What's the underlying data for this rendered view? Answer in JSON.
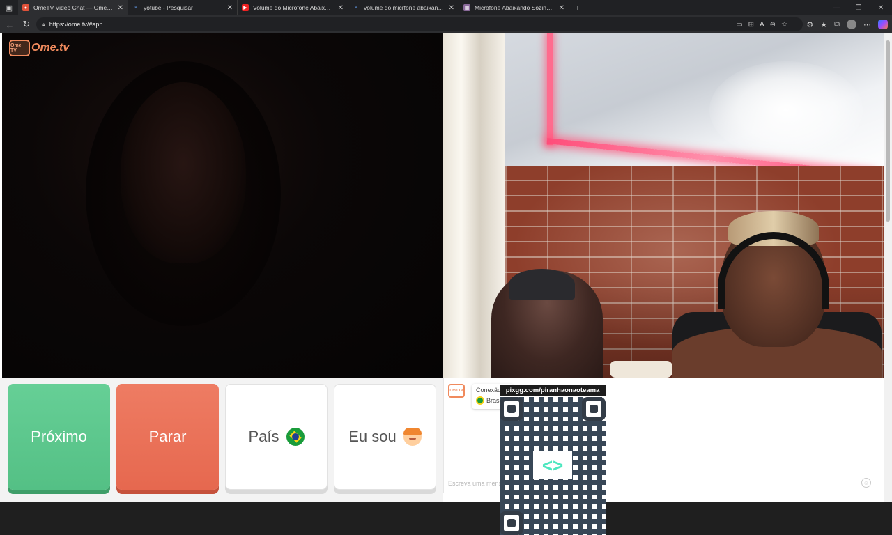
{
  "tabs": [
    {
      "title": "OmeTV Video Chat — Omegle",
      "active": true
    },
    {
      "title": "yotube - Pesquisar",
      "active": false
    },
    {
      "title": "Volume do Microfone Abaixando",
      "active": false
    },
    {
      "title": "volume do micrfone abaixando s",
      "active": false
    },
    {
      "title": "Microfone Abaixando Sozinho (S",
      "active": false
    }
  ],
  "address_bar": {
    "url": "https://ome.tv/#app"
  },
  "logo": {
    "icon_text": "Ome TV",
    "name": "Ome.tv"
  },
  "controls": {
    "next_label": "Próximo",
    "stop_label": "Parar",
    "country_label": "País",
    "gender_label": "Eu sou"
  },
  "chat": {
    "logo_text": "Ome TV",
    "message_line1": "Conexão",
    "message_country": "Brasil",
    "input_placeholder": "Escreva uma mensagem"
  },
  "overlay": {
    "qr_label": "pixgg.com/piranhaonaoteama"
  },
  "colors": {
    "next": "#5cc78d",
    "stop": "#ea7158",
    "brand": "#f08a5d"
  },
  "icons": {
    "country": "brazil-flag-icon",
    "gender": "boy-icon",
    "emoji": "emoji-icon"
  }
}
